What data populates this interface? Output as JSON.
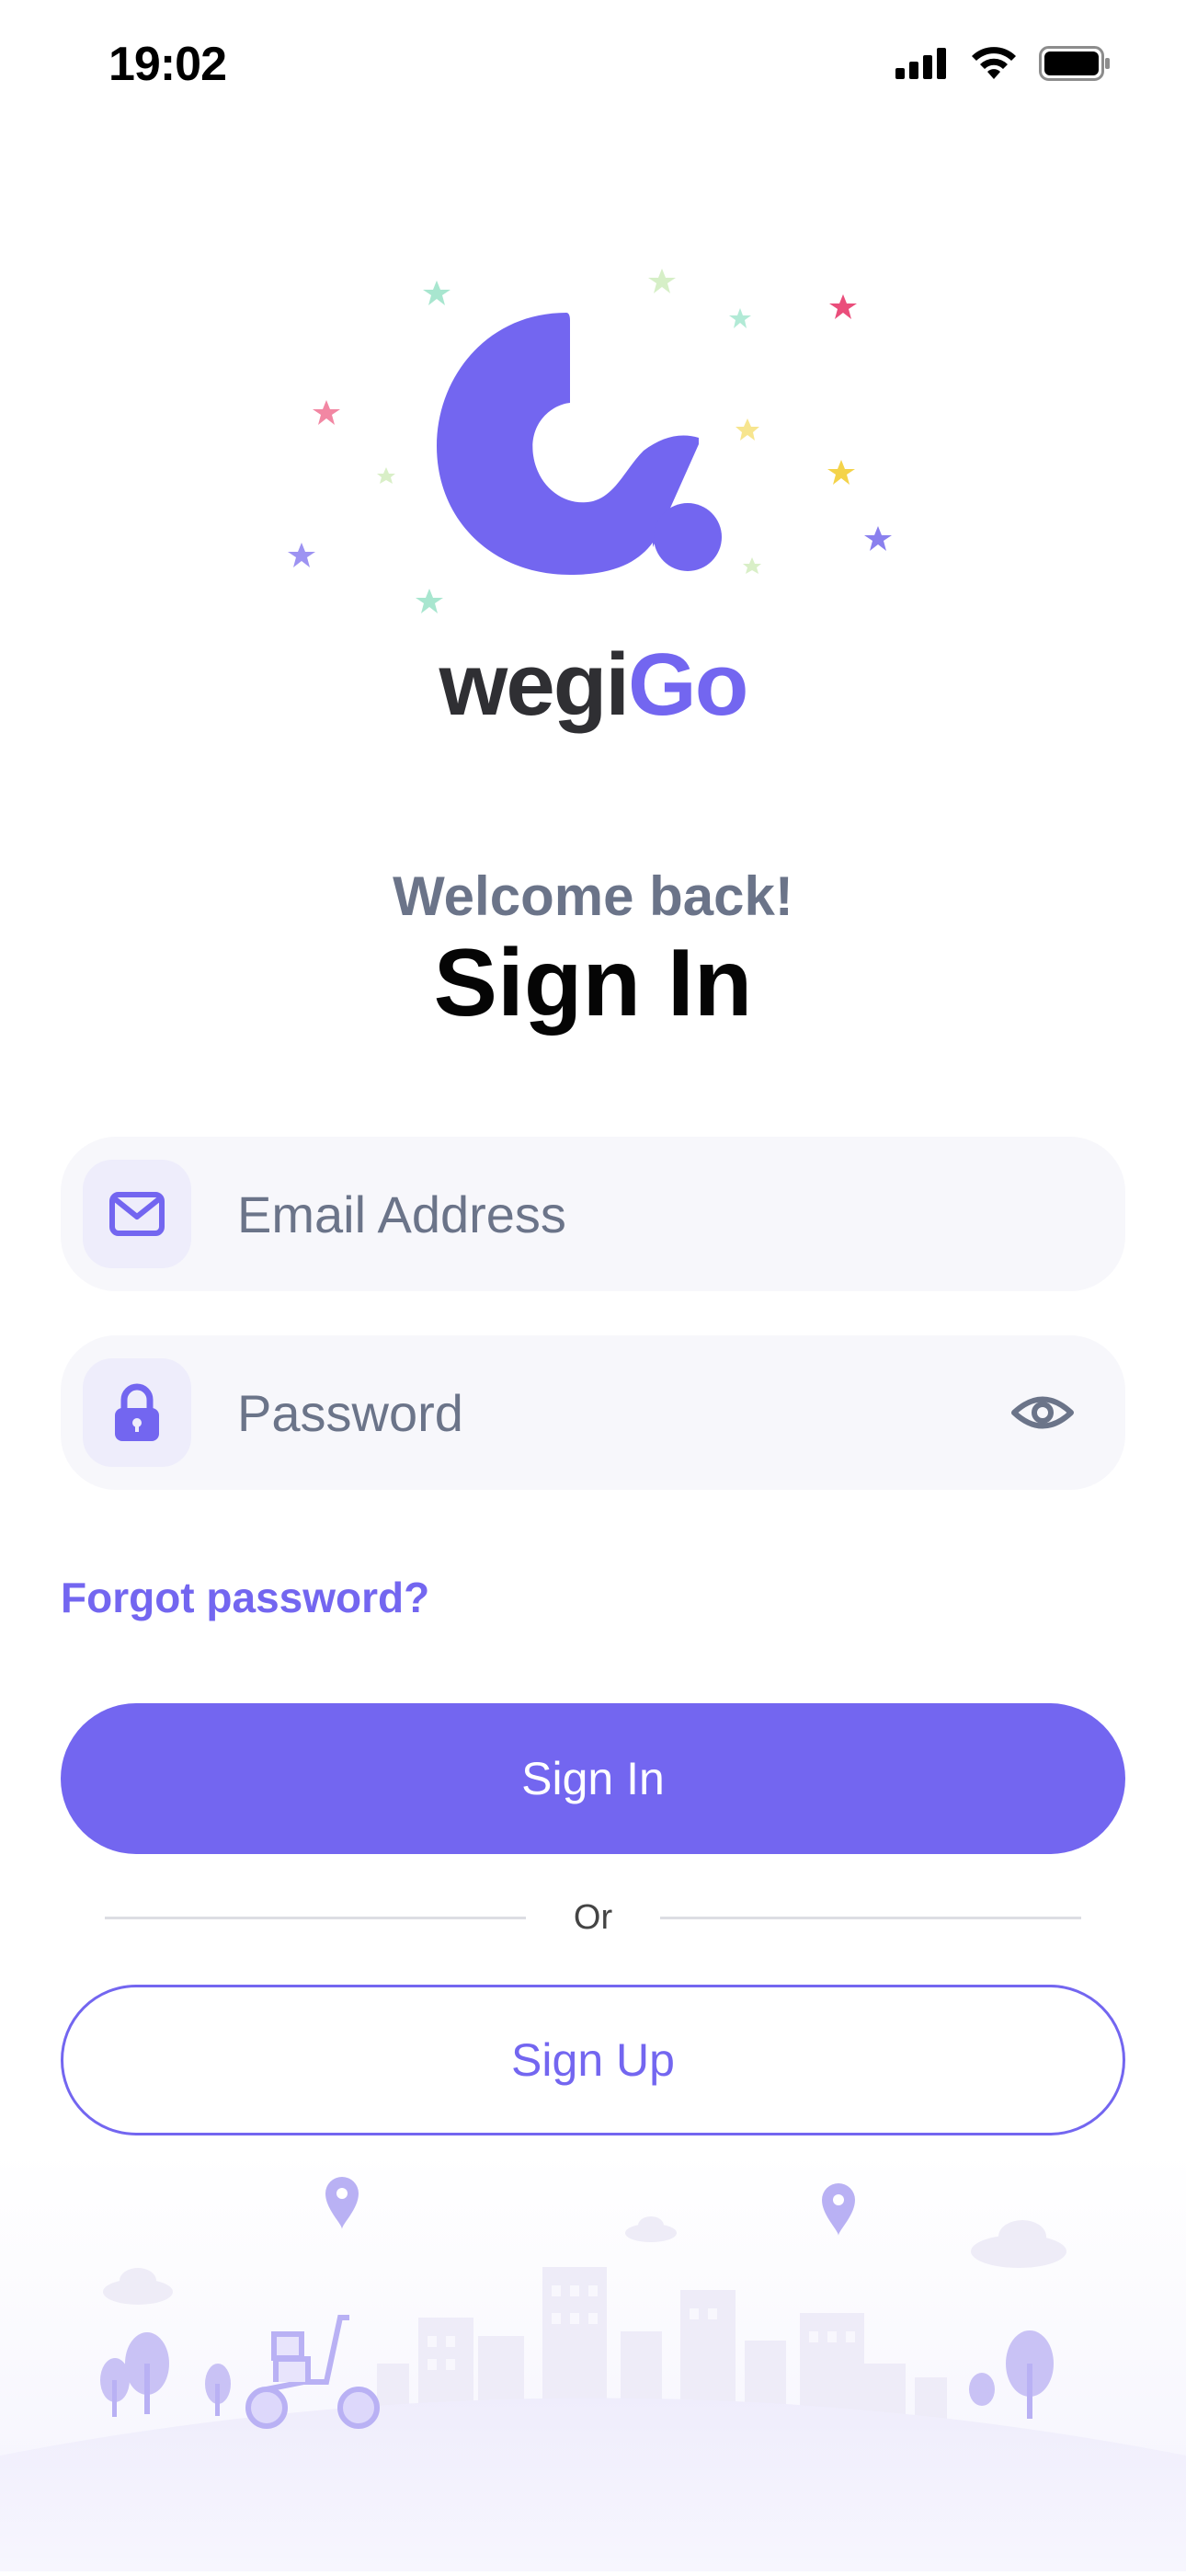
{
  "status_bar": {
    "time": "19:02"
  },
  "brand": {
    "name_part1": "wegi",
    "name_part2": "Go",
    "primary_color": "#7366f0"
  },
  "header": {
    "welcome": "Welcome back!",
    "title": "Sign In"
  },
  "form": {
    "email_placeholder": "Email Address",
    "password_placeholder": "Password",
    "forgot_label": "Forgot password?"
  },
  "actions": {
    "sign_in_label": "Sign In",
    "or_label": "Or",
    "sign_up_label": "Sign Up"
  },
  "icons": {
    "email": "mail-icon",
    "password": "lock-icon",
    "visibility": "eye-icon"
  }
}
